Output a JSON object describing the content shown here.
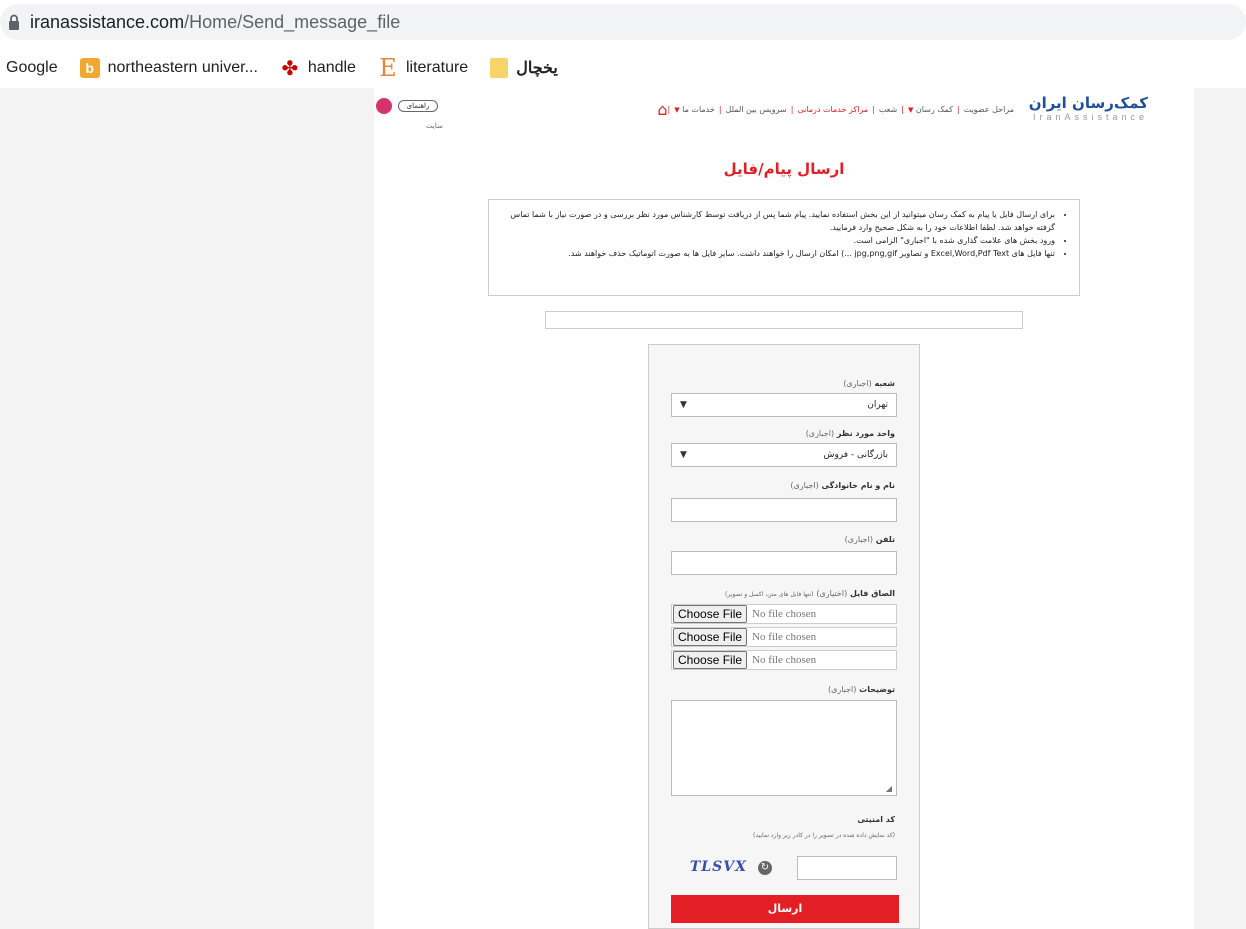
{
  "browser": {
    "url_host": "iranassistance.com",
    "url_path": "/Home/Send_message_file",
    "bookmarks": [
      {
        "label": "Google",
        "icon": "none"
      },
      {
        "label": "northeastern univer...",
        "icon": "bing-icon"
      },
      {
        "label": "handle",
        "icon": "ti-icon"
      },
      {
        "label": "literature",
        "icon": "e-icon"
      },
      {
        "label": "یخچال",
        "icon": "folder-icon"
      }
    ]
  },
  "header": {
    "logo_main": "کمک‌رسان ایران",
    "logo_red": "کمک",
    "logo_sub": "IranAssistance",
    "nav": [
      "خدمات ما",
      "سرویس بین الملل",
      "مراکز خدمات درمانی",
      "شعب",
      "کمک رسان",
      "مراحل عضویت"
    ],
    "help_label": "راهنمای",
    "site_label": "سایت"
  },
  "page": {
    "title": "ارسال پیام/فایل",
    "notice": [
      "برای ارسال فایل یا پیام به کمک رسان میتوانید از این بخش استفاده نمایید. پیام شما پس از دریافت توسط کارشناس مورد نظر بررسی و در صورت نیاز با شما تماس گرفته خواهد شد. لطفا اطلاعات خود را به شکل صحیح وارد فرمایید.",
      "ورود بخش های علامت گذاری شده با \"اجباری\" الزامی است.",
      "تنها فایل های Excel,Word,Pdf Text و تصاویر jpg,png,gif ...) امکان ارسال را خواهند داشت. سایر فایل ها به صورت اتوماتیک حذف خواهند شد."
    ]
  },
  "form": {
    "branch_label": "شعبه",
    "branch_req": "(اجباری)",
    "branch_value": "تهران",
    "unit_label": "واحد مورد نظر",
    "unit_req": "(اجباری)",
    "unit_value": "بازرگانی - فروش",
    "name_label": "نام و نام خانوادگی",
    "name_req": "(اجباری)",
    "phone_label": "تلفن",
    "phone_req": "(اجباری)",
    "attach_label": "الصاق فایل",
    "attach_req": "(اختیاری)",
    "attach_hint": "(تنها فایل های متن، اکسل و تصویر)",
    "choose_file": "Choose File",
    "no_file": "No file chosen",
    "desc_label": "توضیحات",
    "desc_req": "(اجباری)",
    "captcha_label": "کد امنیتی",
    "captcha_hint": "(کد نمایش داده شده در تصویر را در کادر زیر وارد نمایید)",
    "captcha_text": "TLSVX",
    "submit": "ارسال"
  }
}
